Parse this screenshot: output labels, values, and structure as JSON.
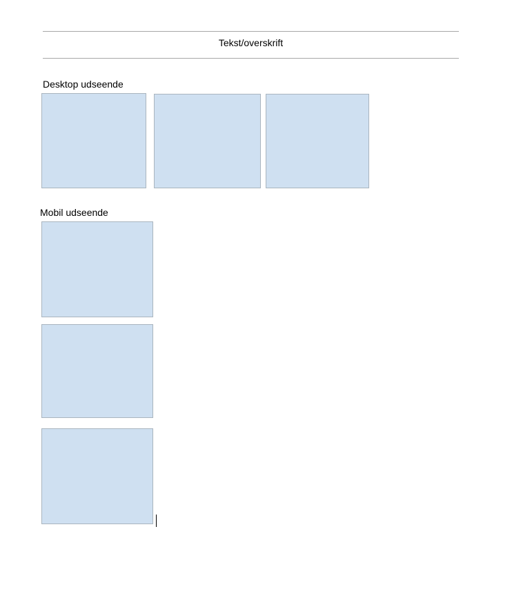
{
  "header": {
    "title": "Tekst/overskrift"
  },
  "sections": {
    "desktop": {
      "label": "Desktop udseende",
      "box_count": 3
    },
    "mobile": {
      "label": "Mobil udseende",
      "box_count": 3
    }
  },
  "colors": {
    "box_fill": "#cfe0f1",
    "box_border": "#a9b4be",
    "rule": "#a6a6a6",
    "text": "#000000"
  }
}
